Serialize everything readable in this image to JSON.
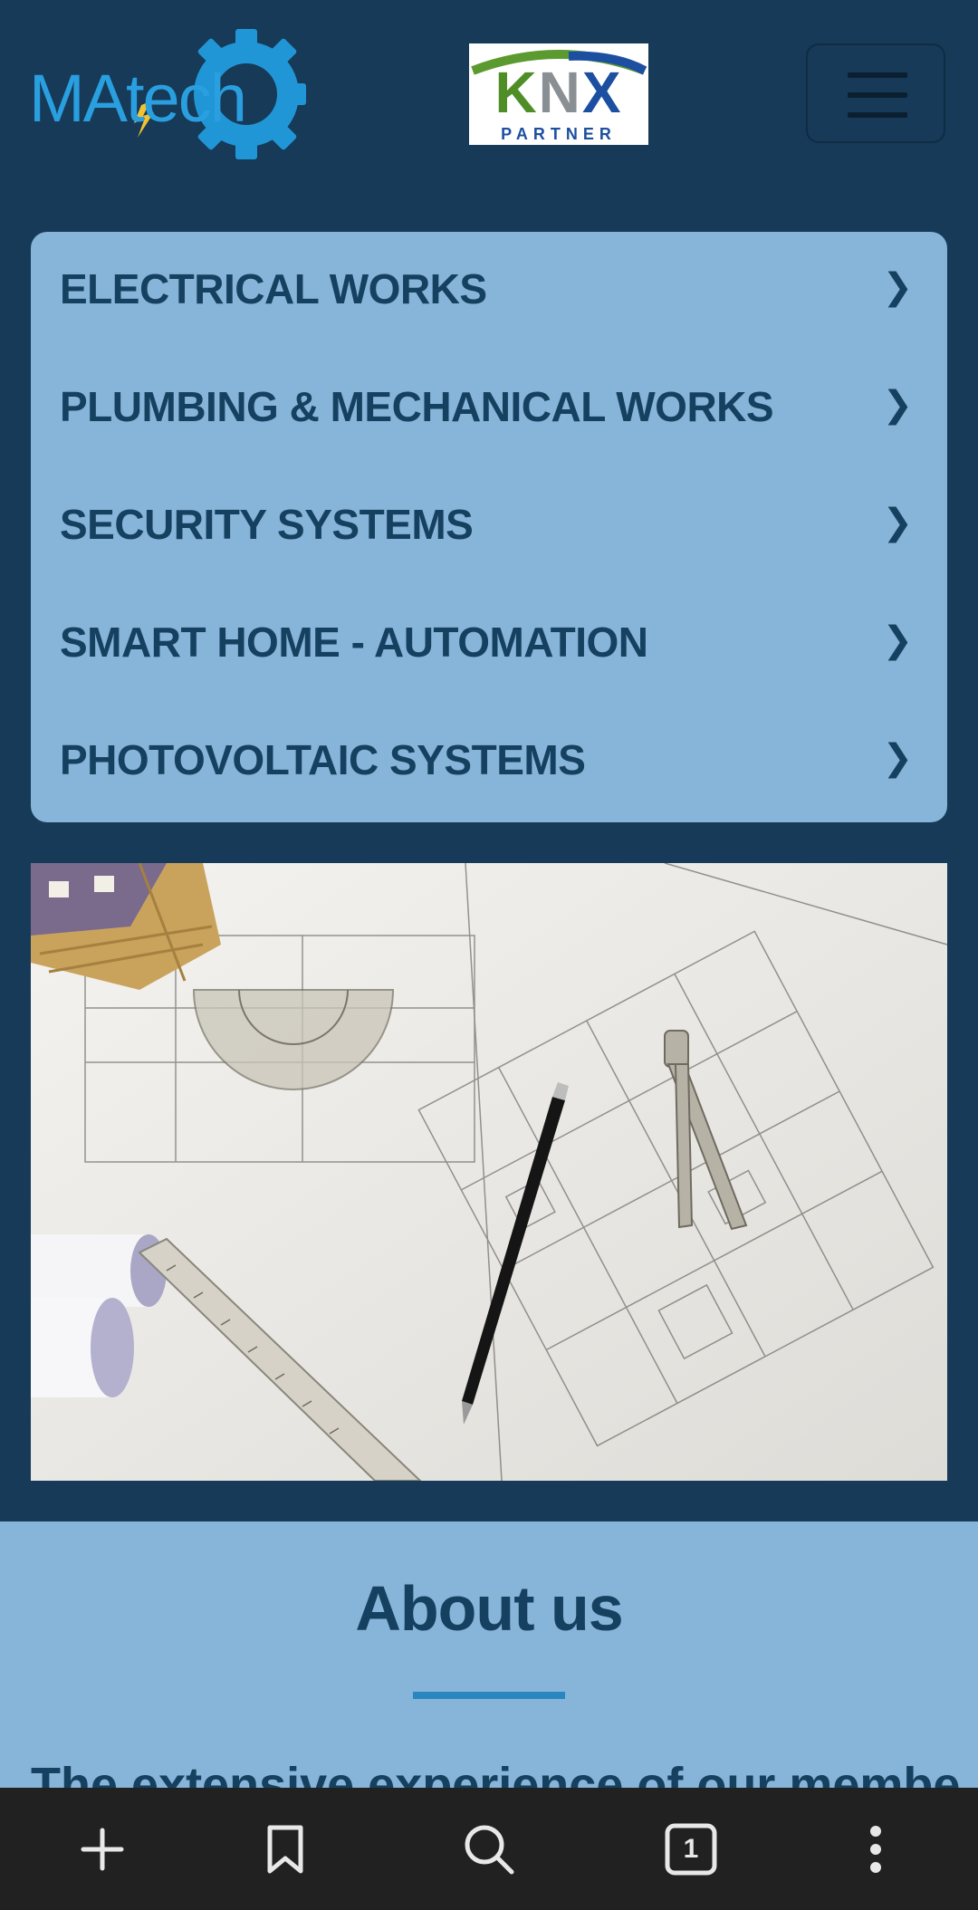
{
  "header": {
    "logo_text": "MAtech",
    "partner_logo": {
      "word": "KNX",
      "subtitle": "PARTNER"
    },
    "menu_icon": "hamburger-icon"
  },
  "services": [
    {
      "label": "ELECTRICAL WORKS",
      "icon": "chevron-right-icon"
    },
    {
      "label": "PLUMBING & MECHANICAL WORKS",
      "icon": "chevron-right-icon"
    },
    {
      "label": "SECURITY SYSTEMS",
      "icon": "chevron-right-icon"
    },
    {
      "label": "SMART HOME - AUTOMATION",
      "icon": "chevron-right-icon"
    },
    {
      "label": "PHOTOVOLTAIC SYSTEMS",
      "icon": "chevron-right-icon"
    }
  ],
  "chevron_glyph": "❯",
  "about": {
    "title": "About us",
    "lead": "The extensive experience of our members"
  },
  "browser_bar": {
    "tab_count": "1",
    "icons": [
      "plus-icon",
      "bookmark-icon",
      "search-icon",
      "tabs-icon",
      "more-vertical-icon"
    ]
  },
  "colors": {
    "page_bg": "#163a57",
    "card_bg": "#87b4d9",
    "text_dark": "#16405f",
    "accent": "#2a86c0",
    "bar_bg": "#212121"
  }
}
